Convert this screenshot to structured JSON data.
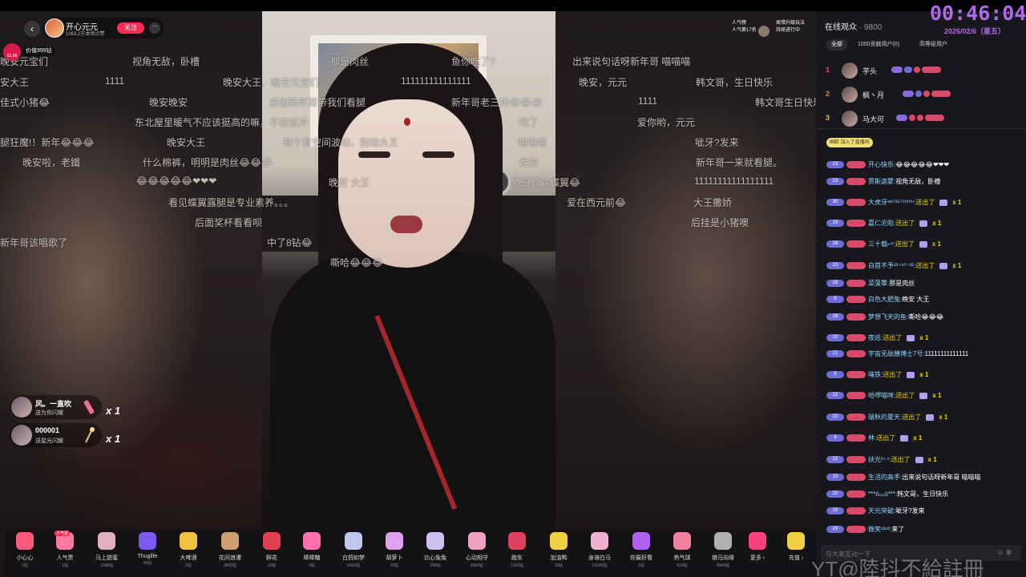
{
  "header": {
    "back_icon": "‹",
    "host_name": "开心元元",
    "host_likes": "1063.2万本场点赞",
    "follow_label": "关注",
    "more_icon": "···",
    "price_label": "价值999钻",
    "rank_tag": "01.08",
    "popularity_label": "人气榜",
    "popularity_rank": "人气第17名",
    "upgrade_tip_line1": "周惜升级玩法",
    "upgrade_tip_line2": "持续进行中"
  },
  "danmaku": [
    "视角无敌，卧槽",
    "那是肉丝",
    "鱼你吃了?",
    "出来说句话呀新年哥 喵喵喵",
    "晚安元宝们",
    "安大王",
    "1111",
    "晚安大王，晚安元宝们",
    "111111111111111",
    "晚安，元元",
    "韩文哥，生日快乐",
    "佳式小猪😂",
    "晚安晚安",
    "感谢新年哥带我们看腿",
    "新年哥老三样😂😂😂",
    "1111",
    "韩文哥生日快乐",
    "东北屋里暖气不应该挺高的嘛，不应该冷",
    "吃了",
    "爱你哟，元元",
    "腿狂魔!！新年😂😂😂",
    "晚安大王",
    "有个有空间波动，别动大王",
    "喵喵喵",
    "呲牙?发来",
    "晚安啦，老鐵",
    "什么棉裤，明明是肉丝😂😂😂",
    "晚安",
    "新年哥一来就看腿。",
    "😂😂😂😂😂❤❤❤",
    "晚安 大王",
    "依旧喜欢蝶翼😂",
    "11111111111111111",
    "看见蝶翼露腿是专业素养。。。",
    "爱在西元前😂",
    "大王撒娇",
    "后面奖杯看看呗",
    "后挂是小猪噢",
    "新年哥该唱歌了",
    "中了8钻😂",
    "嘶哈😂😂😂"
  ],
  "gift_notices": [
    {
      "name": "风。一直吹",
      "sub": "送为你闪耀",
      "count": "x 1"
    },
    {
      "name": "000001",
      "sub": "送星光闪耀",
      "count": "x 1"
    }
  ],
  "gifts": [
    {
      "label": "小心心",
      "price": "1钻",
      "color": "#ff5a7a"
    },
    {
      "label": "人气票",
      "price": "1钻",
      "color": "#ff7aa0",
      "tag": "人气票"
    },
    {
      "label": "马上甜蜜",
      "price": "1288钻",
      "color": "#e0b0c0"
    },
    {
      "label": "Thuglife",
      "price": "99钻",
      "color": "#7a5af0"
    },
    {
      "label": "大啤酒",
      "price": "2钻",
      "color": "#f0c040"
    },
    {
      "label": "花间浪漫",
      "price": "3500钻",
      "color": "#d0a070"
    },
    {
      "label": "鲜花",
      "price": "10钻",
      "color": "#e04050"
    },
    {
      "label": "棒棒糖",
      "price": "9钻",
      "color": "#ff70b0"
    },
    {
      "label": "白鸽如梦",
      "price": "5200钻",
      "color": "#c0c8f0"
    },
    {
      "label": "胡萝卜",
      "price": "10钻",
      "color": "#e0a0f0"
    },
    {
      "label": "比心兔兔",
      "price": "299钻",
      "color": "#d0c0f0"
    },
    {
      "label": "心动相守",
      "price": "8999钻",
      "color": "#f0a0c0"
    },
    {
      "label": "跑车",
      "price": "1200钻",
      "color": "#e04060"
    },
    {
      "label": "加油鸭",
      "price": "15钻",
      "color": "#f0d040"
    },
    {
      "label": "身骑白马",
      "price": "13140钻",
      "color": "#f0b0d0"
    },
    {
      "label": "你最好看",
      "price": "2钻",
      "color": "#b060f0"
    },
    {
      "label": "热气球",
      "price": "520钻",
      "color": "#f080a0"
    },
    {
      "label": "狼马向缘",
      "price": "8999钻",
      "color": "#b0b0b0"
    },
    {
      "label": "更多 ›",
      "price": "",
      "color": "#ff4080"
    },
    {
      "label": "充值 ›",
      "price": "",
      "color": "#f0d040"
    }
  ],
  "panel": {
    "title": "在线观众",
    "count": "· 9800",
    "close_icon": "✕",
    "tabs": [
      "全部",
      "1000贡献用户(0)",
      "高等级用户"
    ],
    "ranks": [
      {
        "num": "1",
        "name": "芋头",
        "color": "#f04060"
      },
      {
        "num": "2",
        "name": "枫丶月",
        "color": "#f08040"
      },
      {
        "num": "3",
        "name": "马大可",
        "color": "#f0c040"
      }
    ],
    "join_text": "画龄 加入了直播间",
    "input_placeholder": "与大家互动一下",
    "input_icons": "☺ ⊕"
  },
  "chat": [
    {
      "lv": "23",
      "name": "开心快乐:",
      "text": "😂😂😂😂😂❤❤❤"
    },
    {
      "lv": "23",
      "name": "贾斯迦蒙:",
      "text": "视角无敌，卧槽"
    },
    {
      "lv": "30",
      "name": "大虎牙ᵃʷ⁷³⁶⁷⁵ʰʳ⁰ⁿ:",
      "sent": "送出了",
      "gift": "x 1"
    },
    {
      "lv": "25",
      "name": "嘉仁沦陷:",
      "sent": "送出了",
      "gift": "x 1"
    },
    {
      "lv": "28",
      "name": "三十载⌐ᵉ:",
      "sent": "送出了",
      "gift": "x 1"
    },
    {
      "lv": "23",
      "name": "白首不予²³⁺¹⁰⁼³²:",
      "sent": "送出了",
      "gift": "x 1"
    },
    {
      "lv": "28",
      "name": "菜菠覃:",
      "text": "那是肉丝"
    },
    {
      "lv": "8",
      "name": "白色大肥兔:",
      "text": "晚安 大王"
    },
    {
      "lv": "28",
      "name": "梦想飞天的鱼:",
      "text": "嘶哈😂😂😂"
    },
    {
      "lv": "20",
      "name": "夜巡:",
      "sent": "送出了",
      "gift": "x 1"
    },
    {
      "lv": "21",
      "name": "宇宙无敌膳博士7号:",
      "text": "11111111111111"
    },
    {
      "lv": "9",
      "name": "嗤铁:",
      "sent": "送出了",
      "gift": "x 1"
    },
    {
      "lv": "22",
      "name": "哈啰喵咪:",
      "sent": "送出了",
      "gift": "x 1"
    },
    {
      "lv": "22",
      "name": "瑞秋的夏天:",
      "sent": "送出了",
      "gift": "x 1"
    },
    {
      "lv": "6",
      "name": "林:",
      "sent": "送出了",
      "gift": "x 1"
    },
    {
      "lv": "22",
      "name": "扶光³⁺⁴:",
      "sent": "送出了",
      "gift": "x 1"
    },
    {
      "lv": "15",
      "name": "生活的高手:",
      "text": "出来说句话呀新年哥 喵喵喵"
    },
    {
      "lv": "20",
      "name": "***ò⌓ó***:",
      "text": "韩文哥，生日快乐"
    },
    {
      "lv": "10",
      "name": "天元突破:",
      "text": "呲牙?发来"
    },
    {
      "lv": "29",
      "name": "微笑¹³ᵒ²:",
      "text": "来了"
    }
  ],
  "overlay": {
    "clock": "00:46:04",
    "date": "2026/02/6（星五）",
    "watermark": "YT@陸抖不給註冊"
  },
  "colors": {
    "accent": "#fe2c55",
    "clock": "#b069e8",
    "panel_bg": "#18171d",
    "level": "#6d6dd8",
    "gold": "#f0d000"
  }
}
